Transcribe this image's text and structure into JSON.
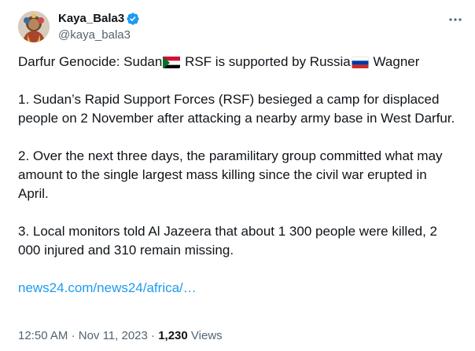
{
  "author": {
    "display_name": "Kaya_Bala3",
    "handle": "@kaya_bala3"
  },
  "tweet": {
    "line1_part1": "Darfur Genocide: Sudan",
    "line1_part2": " RSF is supported by Russia",
    "line1_part3": " Wagner",
    "para1": "1. Sudan’s Rapid Support Forces (RSF) besieged a camp for displaced people on 2 November after attacking a nearby army base in West Darfur.",
    "para2": "2. Over the next three days, the paramilitary group committed what may amount to the single largest mass killing since the civil war erupted in April.",
    "para3": "3. Local monitors told Al Jazeera that about 1 300 people were killed, 2 000 injured and 310 remain missing.",
    "link_text": "news24.com/news24/africa/…"
  },
  "meta": {
    "time": "12:50 AM",
    "date": "Nov 11, 2023",
    "views_count": "1,230",
    "views_label": "Views",
    "separator": "·"
  },
  "icons": {
    "verified": "verified-badge-icon",
    "more": "more-options-icon",
    "flag_sudan": "sudan-flag-icon",
    "flag_russia": "russia-flag-icon"
  },
  "colors": {
    "text_primary": "#0f1419",
    "text_secondary": "#536471",
    "link": "#1d9bf0",
    "verified": "#1d9bf0"
  }
}
